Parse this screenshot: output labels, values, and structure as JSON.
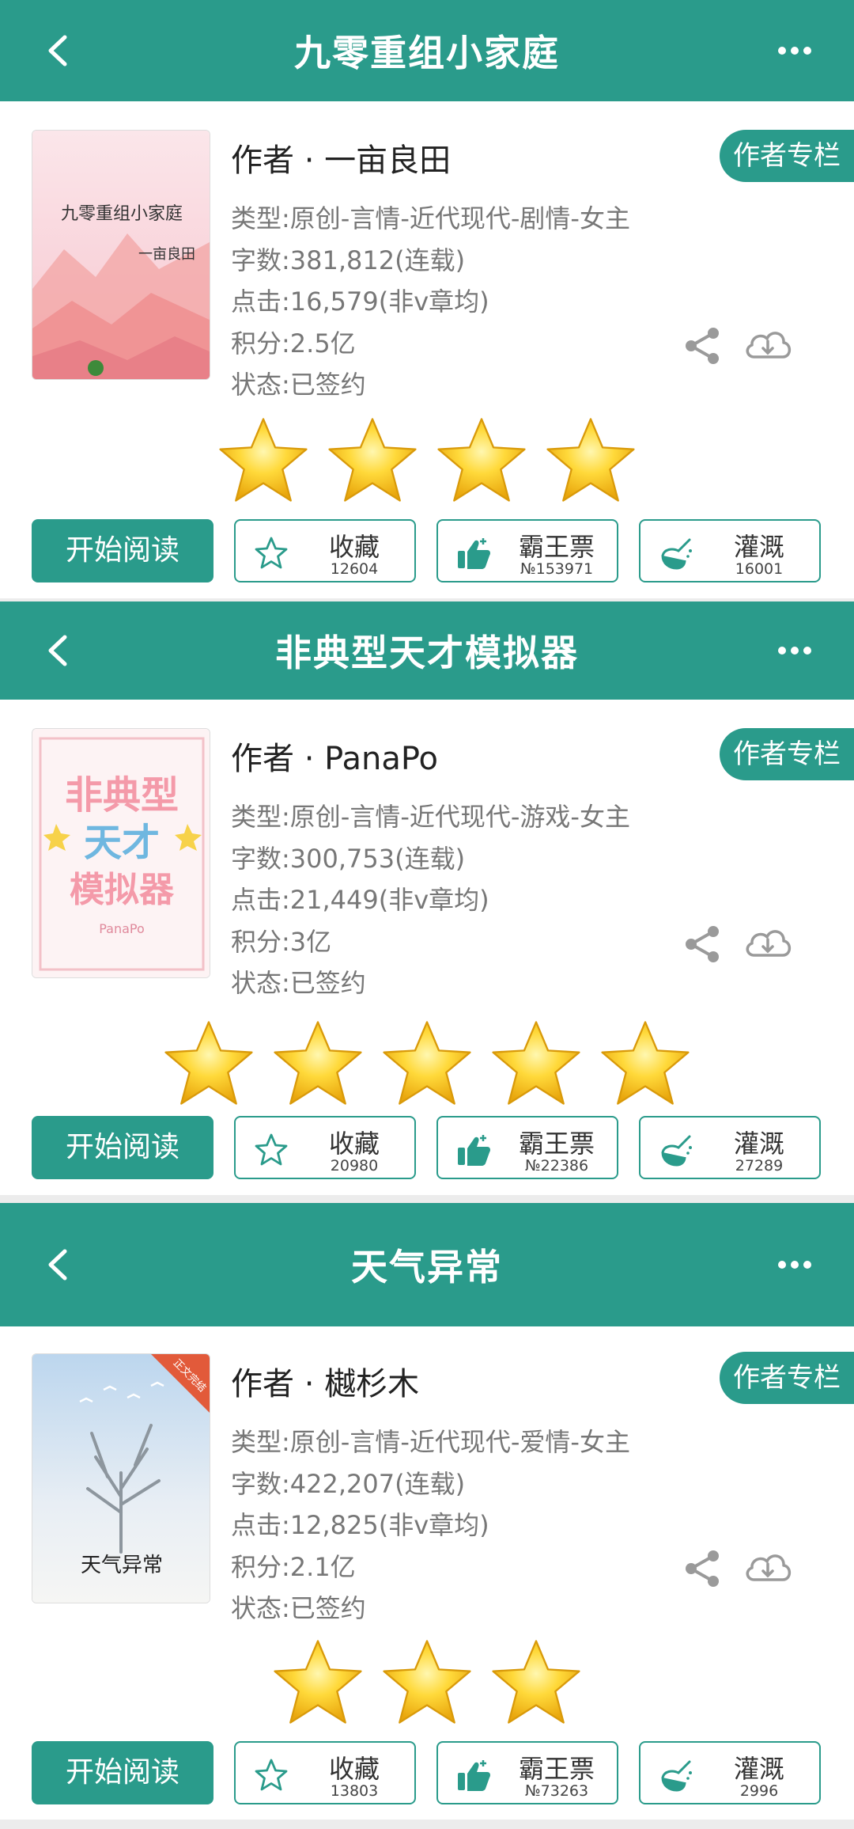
{
  "colors": {
    "accent": "#2a9b8b",
    "star": "#f6c21c"
  },
  "common": {
    "author_column": "作者专栏",
    "start_reading": "开始阅读",
    "favorite": "收藏",
    "overlord_ticket": "霸王票",
    "irrigate": "灌溉"
  },
  "books": [
    {
      "title": "九零重组小家庭",
      "author": "作者 · 一亩良田",
      "type": "类型:原创-言情-近代现代-剧情-女主",
      "words": "字数:381,812(连载)",
      "clicks": "点击:16,579(非v章均)",
      "score": "积分:2.5亿",
      "status": "状态:已签约",
      "stars": 4,
      "favorite_count": "12604",
      "ticket_count": "№153971",
      "irrigate_count": "16001",
      "cover_title": "九零重组小家庭",
      "cover_author": "一亩良田"
    },
    {
      "title": "非典型天才模拟器",
      "author": "作者 · PanaPo",
      "type": "类型:原创-言情-近代现代-游戏-女主",
      "words": "字数:300,753(连载)",
      "clicks": "点击:21,449(非v章均)",
      "score": "积分:3亿",
      "status": "状态:已签约",
      "stars": 5,
      "favorite_count": "20980",
      "ticket_count": "№22386",
      "irrigate_count": "27289",
      "cover_lines": [
        "非典型",
        "天才",
        "模拟器"
      ],
      "cover_author": "PanaPo"
    },
    {
      "title": "天气异常",
      "author": "作者 · 樾杉木",
      "type": "类型:原创-言情-近代现代-爱情-女主",
      "words": "字数:422,207(连载)",
      "clicks": "点击:12,825(非v章均)",
      "score": "积分:2.1亿",
      "status": "状态:已签约",
      "stars": 3,
      "favorite_count": "13803",
      "ticket_count": "№73263",
      "irrigate_count": "2996",
      "cover_title": "天气异常",
      "cover_ribbon": "正文完结"
    }
  ]
}
